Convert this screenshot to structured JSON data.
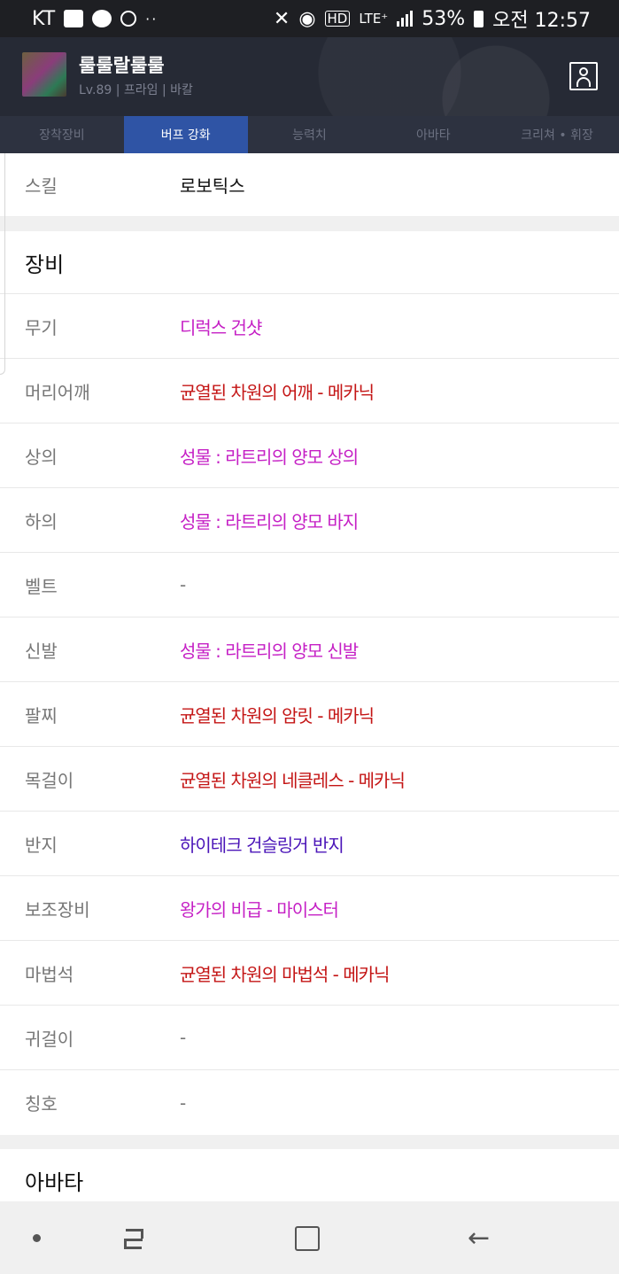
{
  "status_bar": {
    "carrier": "KT",
    "dots": "··",
    "hd": "HD",
    "network": "LTE⁺",
    "battery": "53%",
    "time": "오전 12:57"
  },
  "header": {
    "name": "룰룰랄룰룰",
    "subtitle": "Lv.89 | 프라임 | 바칼"
  },
  "tabs": [
    {
      "label": "장착장비",
      "active": false
    },
    {
      "label": "버프 강화",
      "active": true
    },
    {
      "label": "능력치",
      "active": false
    },
    {
      "label": "아바타",
      "active": false
    },
    {
      "label": "크리쳐 • 휘장",
      "active": false
    }
  ],
  "skill": {
    "label": "스킬",
    "value": "로보틱스"
  },
  "equipment": {
    "title": "장비",
    "rows": [
      {
        "label": "무기",
        "value": "디럭스 건샷",
        "color": "#c520c5"
      },
      {
        "label": "머리어깨",
        "value": "균열된 차원의 어깨 - 메카닉",
        "color": "#c41515"
      },
      {
        "label": "상의",
        "value": "성물 : 라트리의 양모 상의",
        "color": "#c520c5"
      },
      {
        "label": "하의",
        "value": "성물 : 라트리의 양모 바지",
        "color": "#c520c5"
      },
      {
        "label": "벨트",
        "value": "-",
        "color": "#777777"
      },
      {
        "label": "신발",
        "value": "성물 : 라트리의 양모 신발",
        "color": "#c520c5"
      },
      {
        "label": "팔찌",
        "value": "균열된 차원의 암릿 - 메카닉",
        "color": "#c41515"
      },
      {
        "label": "목걸이",
        "value": "균열된 차원의 네클레스 - 메카닉",
        "color": "#c41515"
      },
      {
        "label": "반지",
        "value": "하이테크 건슬링거 반지",
        "color": "#4a14b8"
      },
      {
        "label": "보조장비",
        "value": "왕가의 비급 - 마이스터",
        "color": "#c520c5"
      },
      {
        "label": "마법석",
        "value": "균열된 차원의 마법석 - 메카닉",
        "color": "#c41515"
      },
      {
        "label": "귀걸이",
        "value": "-",
        "color": "#777777"
      },
      {
        "label": "칭호",
        "value": "-",
        "color": "#777777"
      }
    ]
  },
  "avatar_section": {
    "title": "아바타"
  },
  "nav": {
    "back_glyph": "←"
  }
}
